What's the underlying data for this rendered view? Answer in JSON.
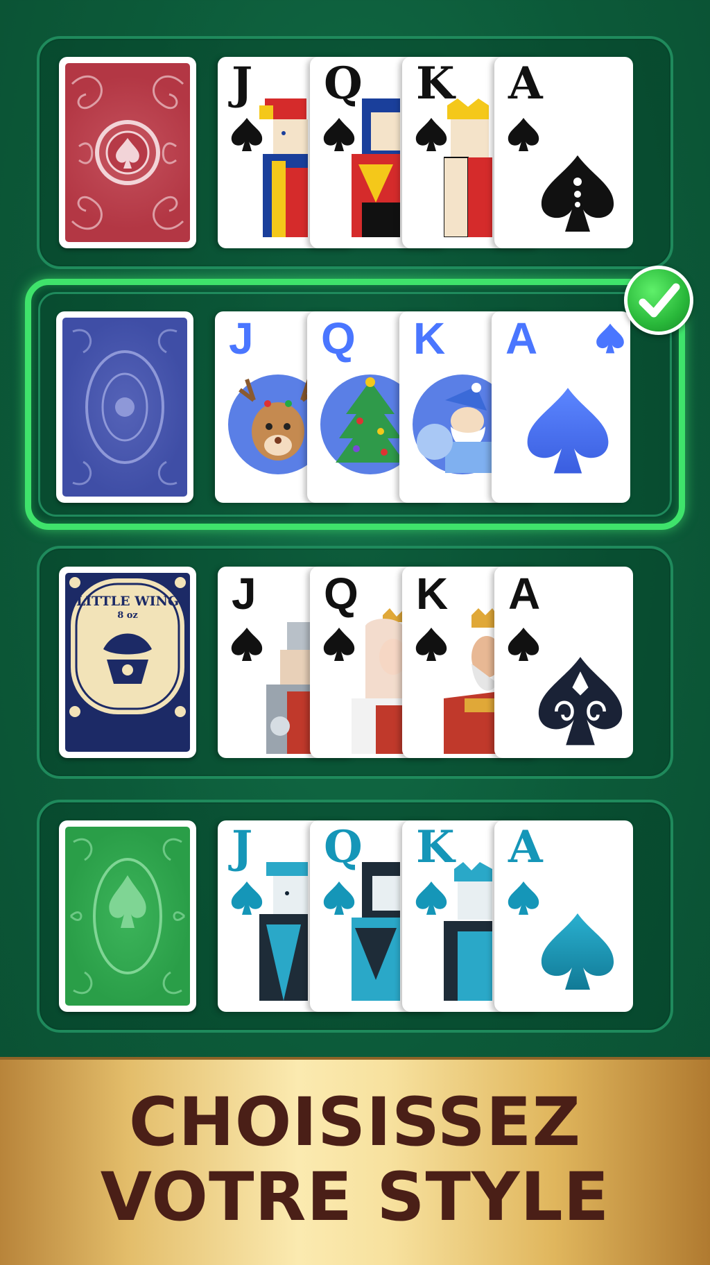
{
  "styles": [
    {
      "id": "classic-red",
      "selected": false,
      "back_color": "#b83b4a",
      "face_rank_color": "#111111",
      "cards": [
        {
          "rank": "J",
          "art": "jack-portrait"
        },
        {
          "rank": "Q",
          "art": "queen-portrait"
        },
        {
          "rank": "K",
          "art": "king-portrait"
        },
        {
          "rank": "A",
          "art": "ace-of-spades"
        }
      ]
    },
    {
      "id": "christmas-blue",
      "selected": true,
      "back_color": "#3f4fa8",
      "face_rank_color": "#4a76ff",
      "cards": [
        {
          "rank": "J",
          "art": "reindeer"
        },
        {
          "rank": "Q",
          "art": "christmas-tree"
        },
        {
          "rank": "K",
          "art": "santa"
        },
        {
          "rank": "A",
          "art": "ace-of-spades"
        }
      ]
    },
    {
      "id": "little-wing",
      "selected": false,
      "back_color": "#1c2a66",
      "back_text": "LITTLE WING",
      "back_subtext": "8 oz",
      "face_rank_color": "#111111",
      "cards": [
        {
          "rank": "J",
          "art": "knight"
        },
        {
          "rank": "Q",
          "art": "snow-queen"
        },
        {
          "rank": "K",
          "art": "bearded-king"
        },
        {
          "rank": "A",
          "art": "ornate-ace-of-spades"
        }
      ]
    },
    {
      "id": "teal-green",
      "selected": false,
      "back_color": "#2ba14a",
      "face_rank_color": "#1596b8",
      "cards": [
        {
          "rank": "J",
          "art": "jack-portrait"
        },
        {
          "rank": "Q",
          "art": "queen-portrait"
        },
        {
          "rank": "K",
          "art": "king-portrait"
        },
        {
          "rank": "A",
          "art": "ace-of-spades"
        }
      ]
    }
  ],
  "banner": {
    "line1": "CHOISISSEZ",
    "line2": "VOTRE STYLE"
  },
  "colors": {
    "table_green": "#0e5f3d",
    "selected_outline": "#3fe36b",
    "banner_text": "#4a1f17"
  },
  "icons": {
    "selected": "check-icon",
    "suit": "spade-icon"
  }
}
